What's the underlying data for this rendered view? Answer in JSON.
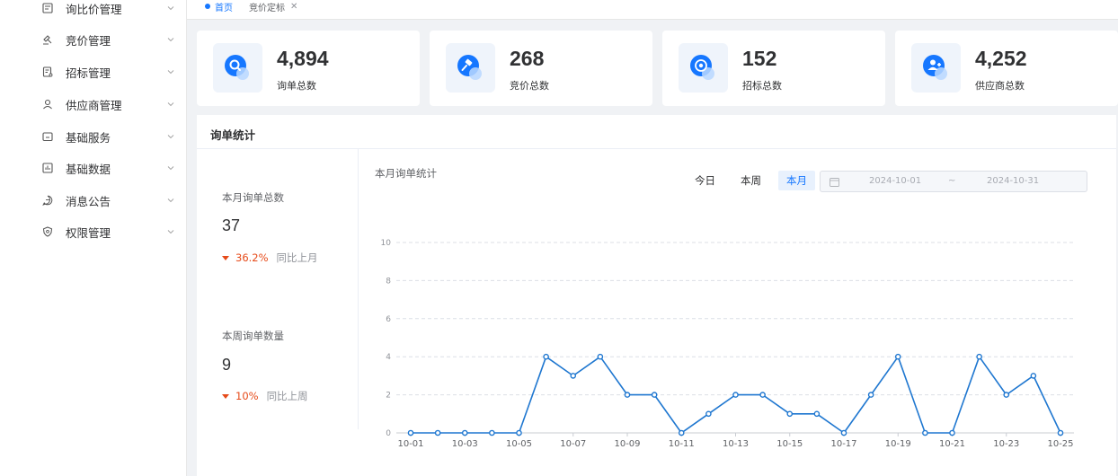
{
  "sidebar": {
    "items": [
      {
        "label": "询比价管理",
        "icon": "form-icon"
      },
      {
        "label": "竞价管理",
        "icon": "hammer-icon"
      },
      {
        "label": "招标管理",
        "icon": "document-icon"
      },
      {
        "label": "供应商管理",
        "icon": "user-icon"
      },
      {
        "label": "基础服务",
        "icon": "folder-icon"
      },
      {
        "label": "基础数据",
        "icon": "bar-chart-icon"
      },
      {
        "label": "消息公告",
        "icon": "message-icon"
      },
      {
        "label": "权限管理",
        "icon": "shield-icon"
      }
    ]
  },
  "tabs": [
    {
      "label": "首页",
      "active": true
    },
    {
      "label": "竞价定标",
      "active": false
    }
  ],
  "cards": [
    {
      "value": "4,894",
      "label": "询单总数",
      "icon": "search-icon"
    },
    {
      "value": "268",
      "label": "竞价总数",
      "icon": "gavel-icon"
    },
    {
      "value": "152",
      "label": "招标总数",
      "icon": "target-icon"
    },
    {
      "value": "4,252",
      "label": "供应商总数",
      "icon": "user-add-icon"
    }
  ],
  "panel": {
    "title": "询单统计",
    "month": {
      "label": "本月询单总数",
      "value": "37",
      "change": "36.2%",
      "compare": "同比上月"
    },
    "week": {
      "label": "本周询单数量",
      "value": "9",
      "change": "10%",
      "compare": "同比上周"
    },
    "chart_title": "本月询单统计",
    "ranges": [
      "今日",
      "本周",
      "本月"
    ],
    "active_range": "本月",
    "date_start": "2024-10-01",
    "date_sep": "~",
    "date_end": "2024-10-31"
  },
  "colors": {
    "accent": "#1677ff",
    "line": "#1f77d0",
    "decrease": "#e64a19"
  },
  "chart_data": {
    "type": "line",
    "title": "本月询单统计",
    "x": [
      "10-01",
      "10-02",
      "10-03",
      "10-04",
      "10-05",
      "10-06",
      "10-07",
      "10-08",
      "10-09",
      "10-10",
      "10-11",
      "10-12",
      "10-13",
      "10-14",
      "10-15",
      "10-16",
      "10-17",
      "10-18",
      "10-19",
      "10-20",
      "10-21",
      "10-22",
      "10-23",
      "10-24",
      "10-25"
    ],
    "tick_labels": [
      "10-01",
      "10-03",
      "10-05",
      "10-07",
      "10-09",
      "10-11",
      "10-13",
      "10-15",
      "10-17",
      "10-19",
      "10-21",
      "10-23",
      "10-25"
    ],
    "values": [
      0,
      0,
      0,
      0,
      0,
      4,
      3,
      4,
      2,
      2,
      0,
      1,
      2,
      2,
      1,
      1,
      0,
      2,
      4,
      0,
      0,
      4,
      2,
      3,
      0
    ],
    "ylim": [
      0,
      10
    ],
    "yticks": [
      0,
      2,
      4,
      6,
      8,
      10
    ],
    "grid": true,
    "xlabel": "",
    "ylabel": ""
  }
}
